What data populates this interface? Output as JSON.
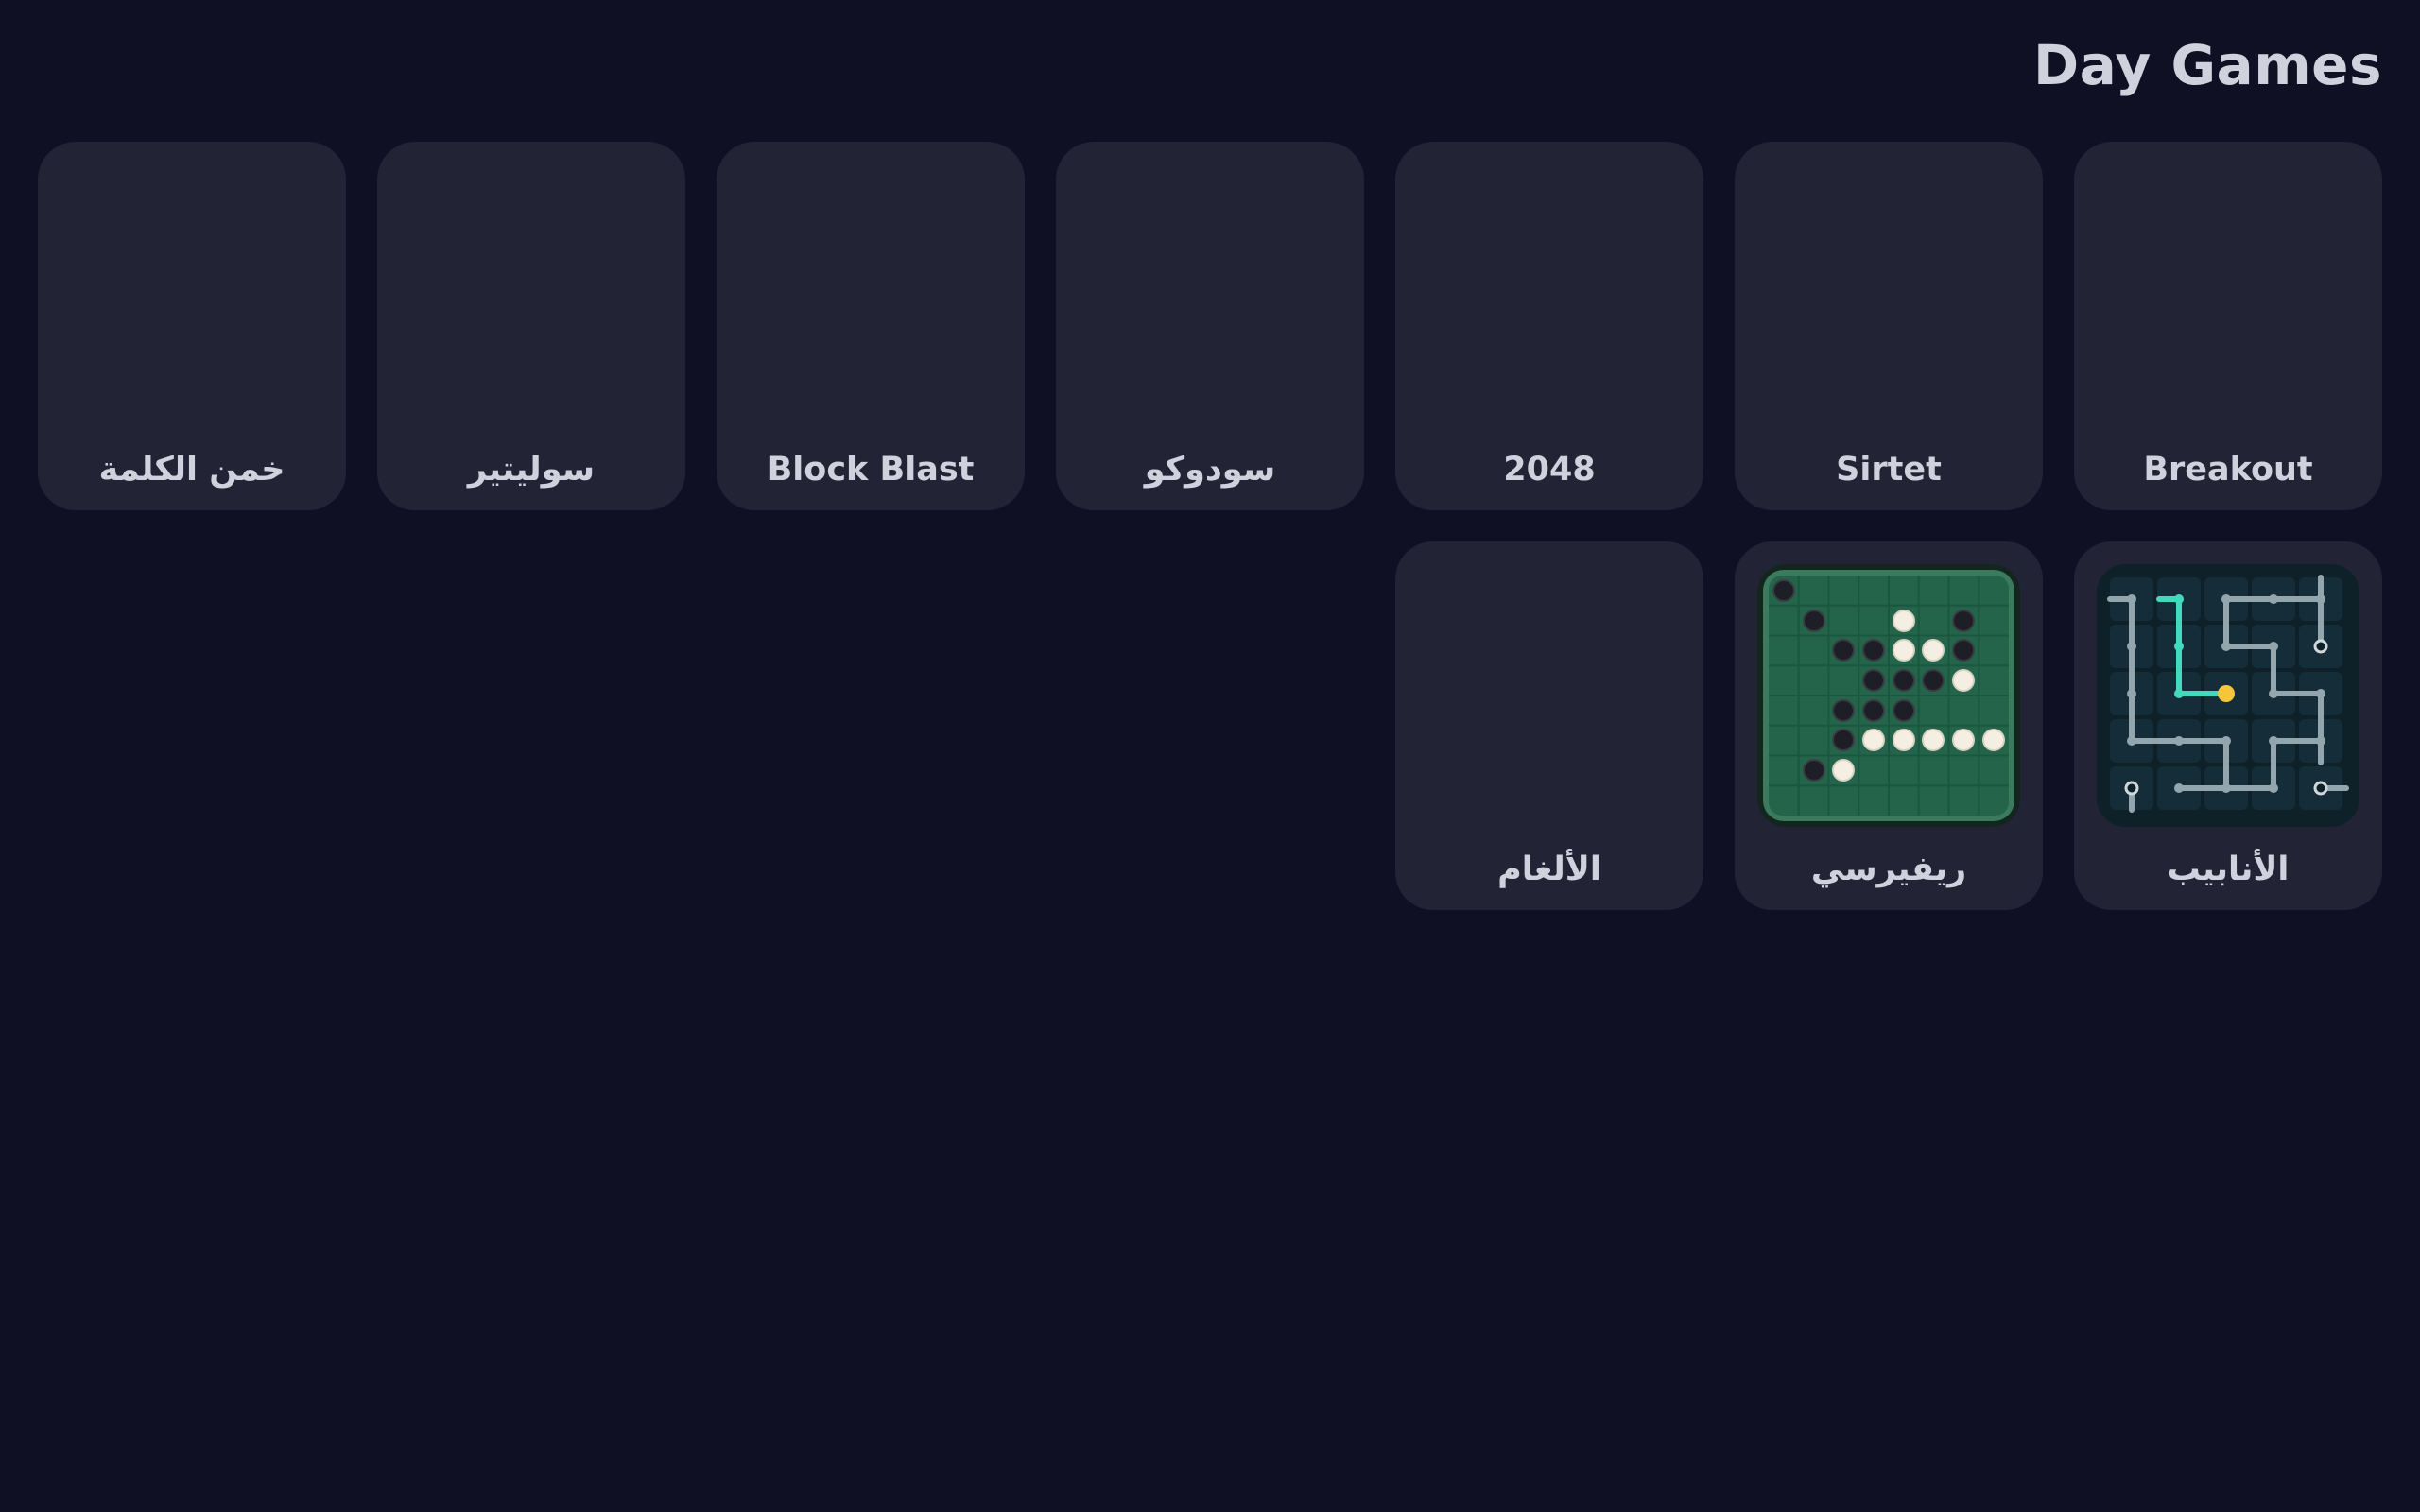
{
  "header": {
    "title": "Day Games"
  },
  "games": [
    {
      "id": "breakout",
      "label": "Breakout",
      "has_thumbnail": false
    },
    {
      "id": "sirtet",
      "label": "Sirtet",
      "has_thumbnail": false
    },
    {
      "id": "2048",
      "label": "2048",
      "has_thumbnail": false
    },
    {
      "id": "sudoku",
      "label": "سودوكو",
      "has_thumbnail": false
    },
    {
      "id": "block-blast",
      "label": "Block Blast",
      "has_thumbnail": false
    },
    {
      "id": "solitaire",
      "label": "سوليتير",
      "has_thumbnail": false
    },
    {
      "id": "guess-word",
      "label": "خمن الكلمة",
      "has_thumbnail": false
    },
    {
      "id": "pipes",
      "label": "الأنابيب",
      "has_thumbnail": true,
      "thumbnail_icon": "pipes-board-icon"
    },
    {
      "id": "reversi",
      "label": "ريفيرسي",
      "has_thumbnail": true,
      "thumbnail_icon": "reversi-board-icon"
    },
    {
      "id": "minesweeper",
      "label": "الألغام",
      "has_thumbnail": false
    }
  ],
  "colors": {
    "background": "#0f1023",
    "card": "#232336",
    "text": "#cfd1dc",
    "reversi_board": "#2a6a50",
    "pipes_board": "#0e2129",
    "pipe_active": "#43d9bf",
    "pipe_inactive": "#93a6ad",
    "pipe_source": "#f5c63a"
  }
}
